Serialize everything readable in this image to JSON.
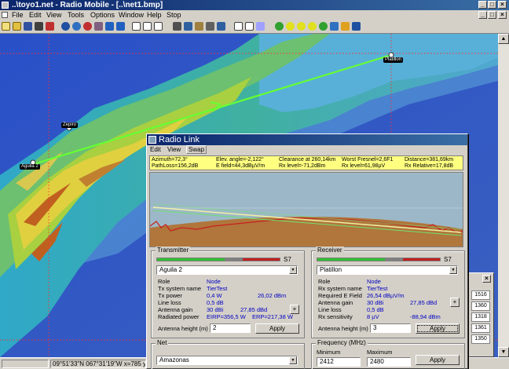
{
  "window": {
    "title": "..\\toyo1.net - Radio Mobile - [..\\net1.bmp]",
    "minimize": "_",
    "maximize": "□",
    "close": "×"
  },
  "menu": [
    "File",
    "Edit",
    "View",
    "Tools",
    "Options",
    "Window",
    "Help",
    "Stop"
  ],
  "map": {
    "sites": [
      "Platillon",
      "Zepiro",
      "Aguila 2"
    ]
  },
  "status": {
    "coords": "09°51'33\"N 067°31'19\"W x=785 y=78"
  },
  "dialog": {
    "title": "Radio Link",
    "menu": [
      "Edit",
      "View",
      "Swap"
    ],
    "info": {
      "azimuth": "Azimuth=72,3°",
      "elev": "Elev. angle=-2,122°",
      "clearance": "Clearance at 260,14km",
      "fresnel": "Worst Fresnel=2,6F1",
      "distance": "Distance=381,69km",
      "pathloss": "PathLoss=156,2dB",
      "efield": "E field=44,3dBµV/m",
      "rxlevel": "Rx level=-71,2dBm",
      "rxlevel_uv": "Rx level=61,98µV",
      "rxrel": "Rx Relative=17,8dB"
    },
    "transmitter": {
      "title": "Transmitter",
      "meter_label": "S7",
      "site": "Aguila 2",
      "rows": [
        {
          "label": "Role",
          "value": "Node",
          "value2": ""
        },
        {
          "label": "Tx system name",
          "value": "TierTest",
          "value2": ""
        },
        {
          "label": "Tx power",
          "value": "0,4 W",
          "value2": "26,02 dBm"
        },
        {
          "label": "Line loss",
          "value": "0,5 dB",
          "value2": ""
        },
        {
          "label": "Antenna gain",
          "value": "30 dBi",
          "value2": "27,85 dBd"
        },
        {
          "label": "Radiated power",
          "value": "EIRP=356,5 W",
          "value2": "ERP=217,38 W"
        }
      ],
      "height_label": "Antenna height (m)",
      "height_value": "2",
      "apply": "Apply",
      "plus": "+"
    },
    "receiver": {
      "title": "Receiver",
      "meter_label": "S7",
      "site": "Platillon",
      "rows": [
        {
          "label": "Role",
          "value": "Node",
          "value2": ""
        },
        {
          "label": "Rx system name",
          "value": "TierTest",
          "value2": ""
        },
        {
          "label": "Required E Field",
          "value": "26,54 dBµV/m",
          "value2": ""
        },
        {
          "label": "Antenna gain",
          "value": "30 dBi",
          "value2": "27,85 dBd"
        },
        {
          "label": "Line loss",
          "value": "0,5 dB",
          "value2": ""
        },
        {
          "label": "Rx sensitivity",
          "value": "8 µV",
          "value2": "-88,94 dBm"
        }
      ],
      "height_label": "Antenna height (m)",
      "height_value": "3",
      "apply": "Apply",
      "plus": "+"
    },
    "net": {
      "title": "Net",
      "value": "Amazonas"
    },
    "frequency": {
      "title": "Frequency (MHz)",
      "min_label": "Minimum",
      "max_label": "Maximum",
      "min": "2412",
      "max": "2480",
      "apply": "Apply"
    }
  },
  "sidewin": {
    "close": "×",
    "values": [
      "1516",
      "1360",
      "1318",
      "1361",
      "1350"
    ]
  },
  "colors": {
    "titlebar": "#0a246a",
    "info_panel": "#ffff80",
    "link_line": "#66ff33",
    "sea": "#2f57c0"
  }
}
